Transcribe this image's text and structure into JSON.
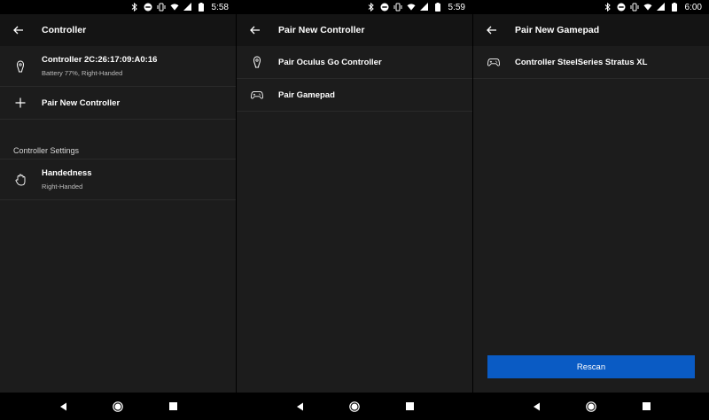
{
  "colors": {
    "background": "#1c1c1c",
    "appbar": "#141414",
    "accent": "#0a5bc4",
    "divider": "#2a2a2a"
  },
  "screens": [
    {
      "time": "5:58",
      "title": "Controller",
      "items": [
        {
          "icon": "controller-icon",
          "primary": "Controller 2C:26:17:09:A0:16",
          "secondary": "Battery 77%, Right-Handed"
        },
        {
          "icon": "plus-icon",
          "primary": "Pair New Controller"
        }
      ],
      "section_header": "Controller Settings",
      "settings": [
        {
          "icon": "hand-icon",
          "primary": "Handedness",
          "secondary": "Right-Handed"
        }
      ]
    },
    {
      "time": "5:59",
      "title": "Pair New Controller",
      "items": [
        {
          "icon": "controller-icon",
          "primary": "Pair Oculus Go Controller"
        },
        {
          "icon": "gamepad-icon",
          "primary": "Pair Gamepad"
        }
      ]
    },
    {
      "time": "6:00",
      "title": "Pair New Gamepad",
      "items": [
        {
          "icon": "gamepad-icon",
          "primary": "Controller SteelSeries Stratus XL"
        }
      ],
      "button": "Rescan"
    }
  ]
}
